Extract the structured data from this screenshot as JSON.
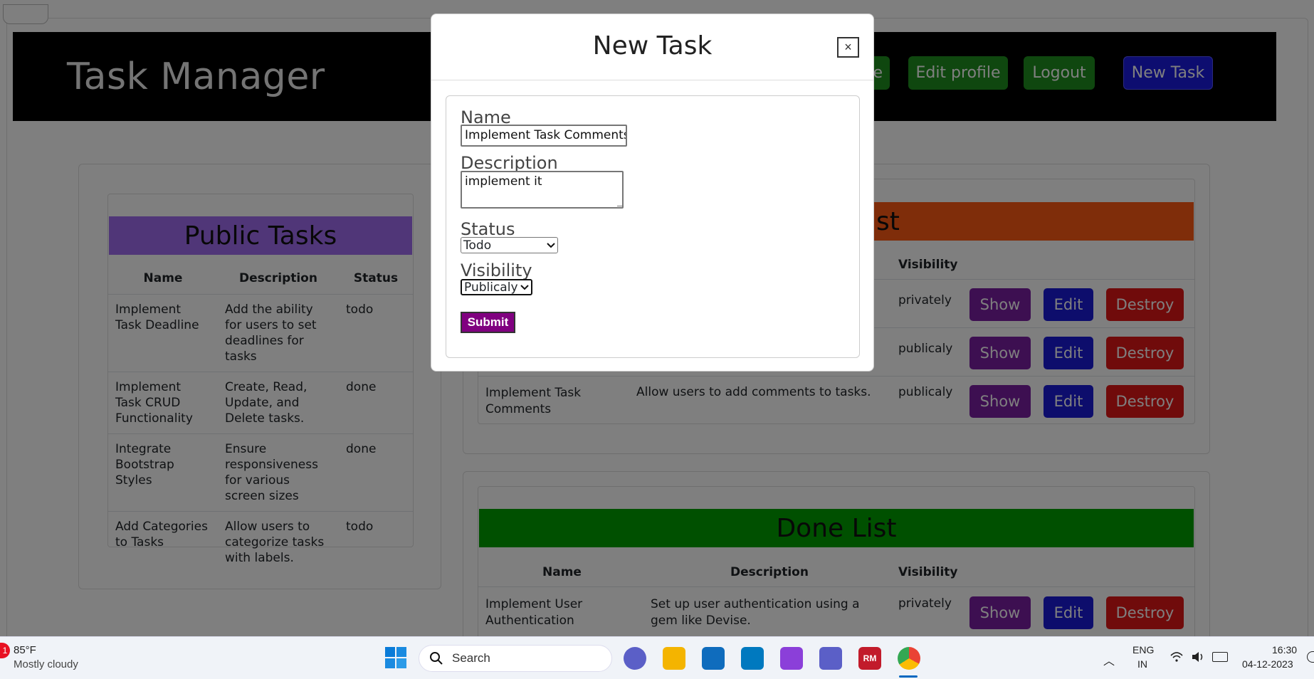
{
  "app": {
    "brand": "Task Manager"
  },
  "nav": {
    "partial_label": "e",
    "edit_profile": "Edit profile",
    "logout": "Logout",
    "new_task": "New Task"
  },
  "public_tasks": {
    "title": "Public Tasks",
    "headers": [
      "Name",
      "Description",
      "Status"
    ],
    "rows": [
      {
        "name": "Implement Task Deadline",
        "description": "Add the ability for users to set deadlines for tasks",
        "status": "todo"
      },
      {
        "name": "Implement Task CRUD Functionality",
        "description": "Create, Read, Update, and Delete tasks.",
        "status": "done"
      },
      {
        "name": "Integrate Bootstrap Styles",
        "description": "Ensure responsiveness for various screen sizes",
        "status": "done"
      },
      {
        "name": "Add Categories to Tasks",
        "description": "Allow users to categorize tasks with labels.",
        "status": "todo"
      }
    ]
  },
  "todo_list": {
    "title_partial": "st",
    "headers": {
      "visibility": "Visibility"
    },
    "rows": [
      {
        "name": "",
        "description": "",
        "visibility": "privately"
      },
      {
        "name": "",
        "description": "",
        "visibility": "publicaly"
      },
      {
        "name": "Implement Task Comments",
        "description": "Allow users to add comments to tasks.",
        "visibility": "publicaly"
      }
    ],
    "actions": {
      "show": "Show",
      "edit": "Edit",
      "destroy": "Destroy"
    }
  },
  "done_list": {
    "title": "Done List",
    "headers": [
      "Name",
      "Description",
      "Visibility"
    ],
    "rows": [
      {
        "name": "Implement User Authentication",
        "description": "Set up user authentication using a gem like Devise.",
        "visibility": "privately"
      }
    ]
  },
  "modal": {
    "title": "New Task",
    "close": "×",
    "name_label": "Name",
    "name_value": "Implement Task Comments",
    "description_label": "Description",
    "description_value": "implement it",
    "status_label": "Status",
    "status_value": "Todo",
    "visibility_label": "Visibility",
    "visibility_value": "Publicaly",
    "submit": "Submit"
  },
  "taskbar": {
    "weather_badge": "1",
    "temperature": "85°F",
    "weather": "Mostly cloudy",
    "search_placeholder": "Search",
    "lang": "ENG",
    "region": "IN",
    "time": "16:30",
    "date": "04-12-2023",
    "rm_label": "RM"
  },
  "colors": {
    "navbar": "#000000",
    "nav_green": "#1f8f1f",
    "nav_blue": "#1b1be0",
    "public_bar": "#a06cf0",
    "todo_bar": "#ff5a14",
    "done_bar": "#00a000",
    "show": "#7a1fa2",
    "edit": "#1b1bd9",
    "destroy": "#e01616",
    "submit": "#800080"
  }
}
